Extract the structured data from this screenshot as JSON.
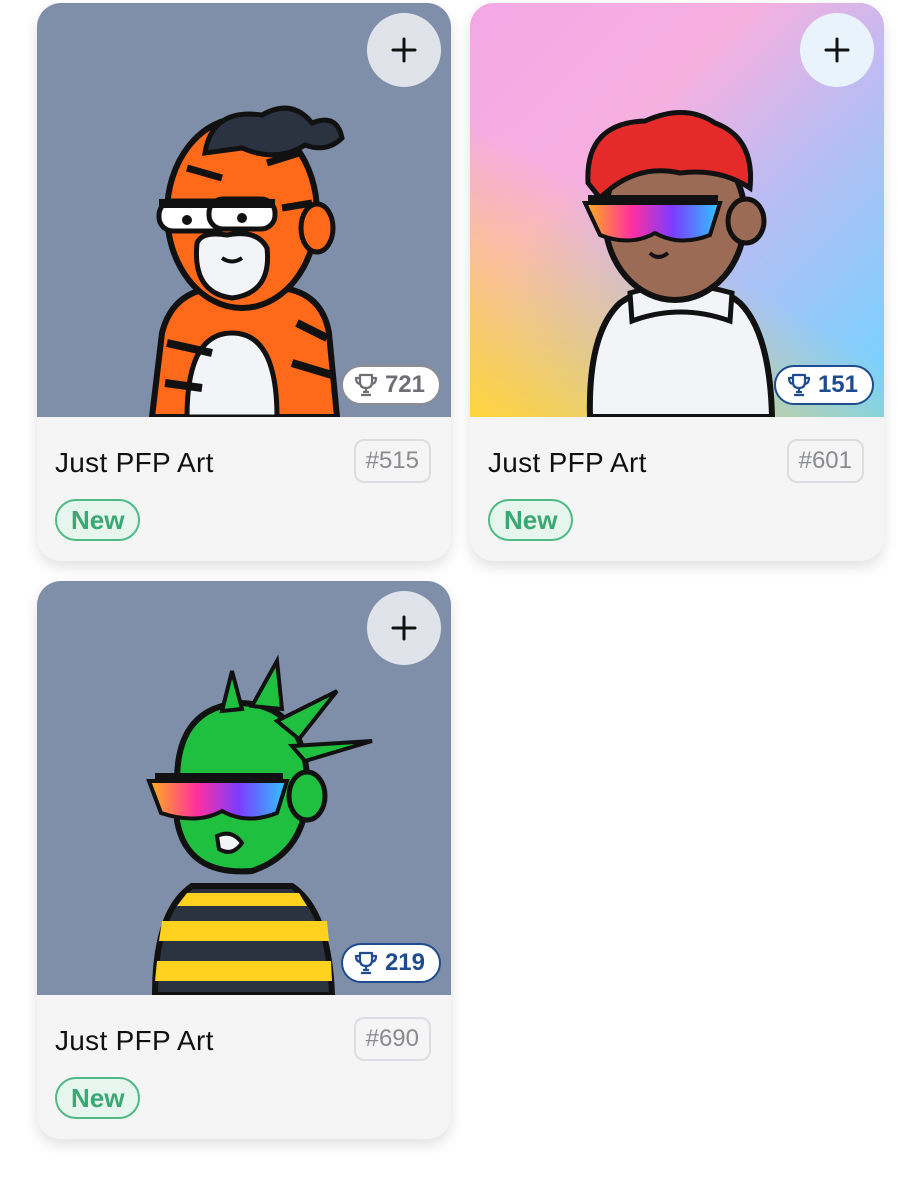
{
  "colors": {
    "card_bg": "#f5f5f6",
    "slate_bg": "#7f8fa9",
    "badge_green": "#3aa873",
    "score_blue": "#1f4b8f",
    "score_gray": "#6d6f74"
  },
  "icons": {
    "add": "plus-icon",
    "score": "trophy-icon"
  },
  "cards": [
    {
      "title": "Just PFP Art",
      "token_id": "#515",
      "badge": "New",
      "score": "721",
      "background": "slate",
      "character": "tiger"
    },
    {
      "title": "Just PFP Art",
      "token_id": "#601",
      "badge": "New",
      "score": "151",
      "background": "gradient",
      "character": "red-hair"
    },
    {
      "title": "Just PFP Art",
      "token_id": "#690",
      "badge": "New",
      "score": "219",
      "background": "slate",
      "character": "green-alien"
    }
  ]
}
